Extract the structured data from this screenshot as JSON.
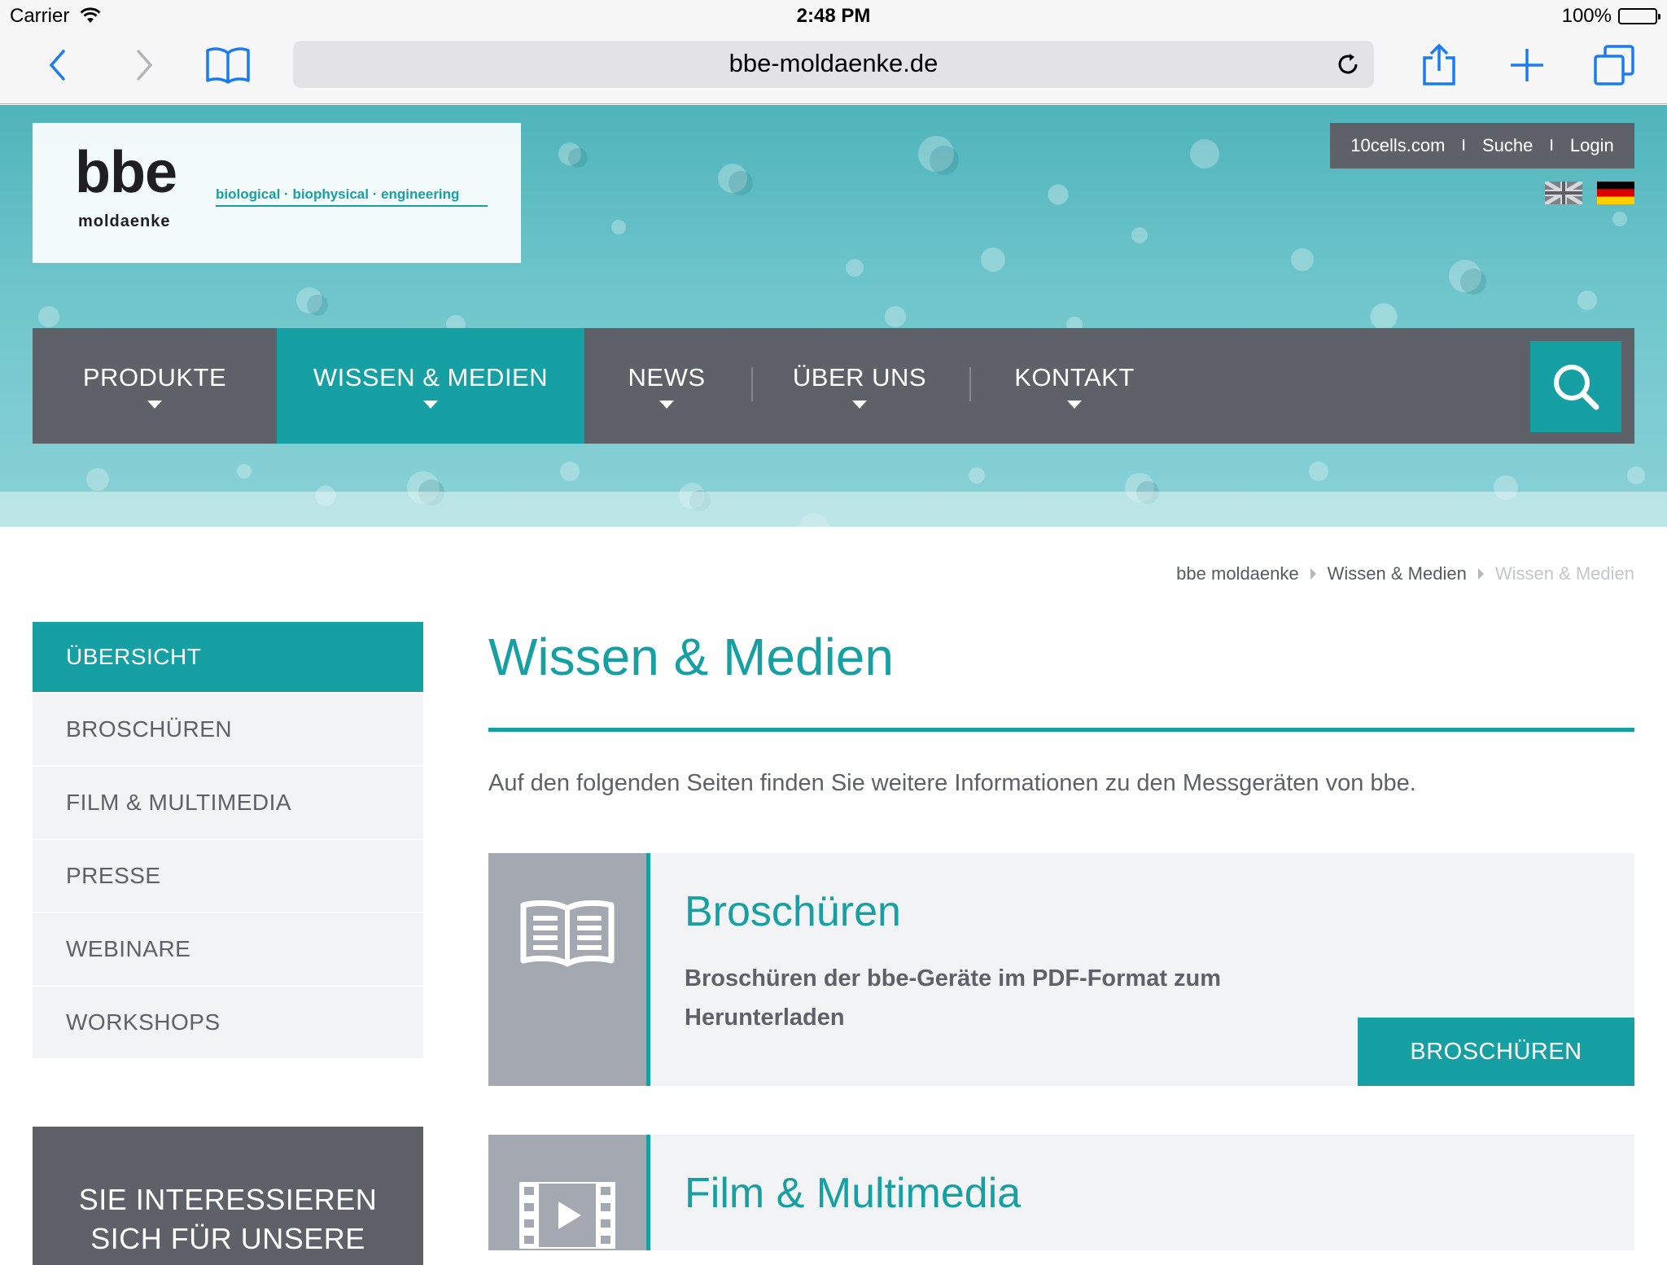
{
  "status_bar": {
    "carrier": "Carrier",
    "time": "2:48 PM",
    "battery": "100%"
  },
  "browser": {
    "url": "bbe-moldaenke.de"
  },
  "header": {
    "logo": {
      "name": "bbe",
      "tagline": "biological · biophysical · engineering",
      "subtitle": "moldaenke"
    },
    "top_links": [
      "10cells.com",
      "Suche",
      "Login"
    ],
    "top_link_separator": "I",
    "languages": [
      "english-flag-icon",
      "german-flag-icon"
    ]
  },
  "nav": {
    "items": [
      {
        "label": "PRODUKTE"
      },
      {
        "label": "WISSEN & MEDIEN",
        "active": true
      },
      {
        "label": "NEWS"
      },
      {
        "label": "ÜBER UNS"
      },
      {
        "label": "KONTAKT"
      }
    ],
    "accent": "#17a0a3",
    "bar_color": "#5f6169"
  },
  "breadcrumb": [
    "bbe moldaenke",
    "Wissen & Medien",
    "Wissen & Medien"
  ],
  "sidebar": {
    "items": [
      {
        "label": "ÜBERSICHT",
        "active": true
      },
      {
        "label": "BROSCHÜREN"
      },
      {
        "label": "FILM & MULTIMEDIA"
      },
      {
        "label": "PRESSE"
      },
      {
        "label": "WEBINARE"
      },
      {
        "label": "WORKSHOPS"
      }
    ],
    "promo_line1": "SIE INTERESSIEREN",
    "promo_line2": "SICH FÜR UNSERE"
  },
  "main": {
    "title": "Wissen & Medien",
    "intro": "Auf den folgenden Seiten finden Sie weitere Informationen zu den Messgeräten von bbe.",
    "cards": [
      {
        "icon": "book-icon",
        "title": "Broschüren",
        "description": "Broschüren der bbe-Geräte im PDF-Format zum Herunterladen",
        "button": "BROSCHÜREN"
      },
      {
        "icon": "film-icon",
        "title": "Film & Multimedia"
      }
    ]
  }
}
